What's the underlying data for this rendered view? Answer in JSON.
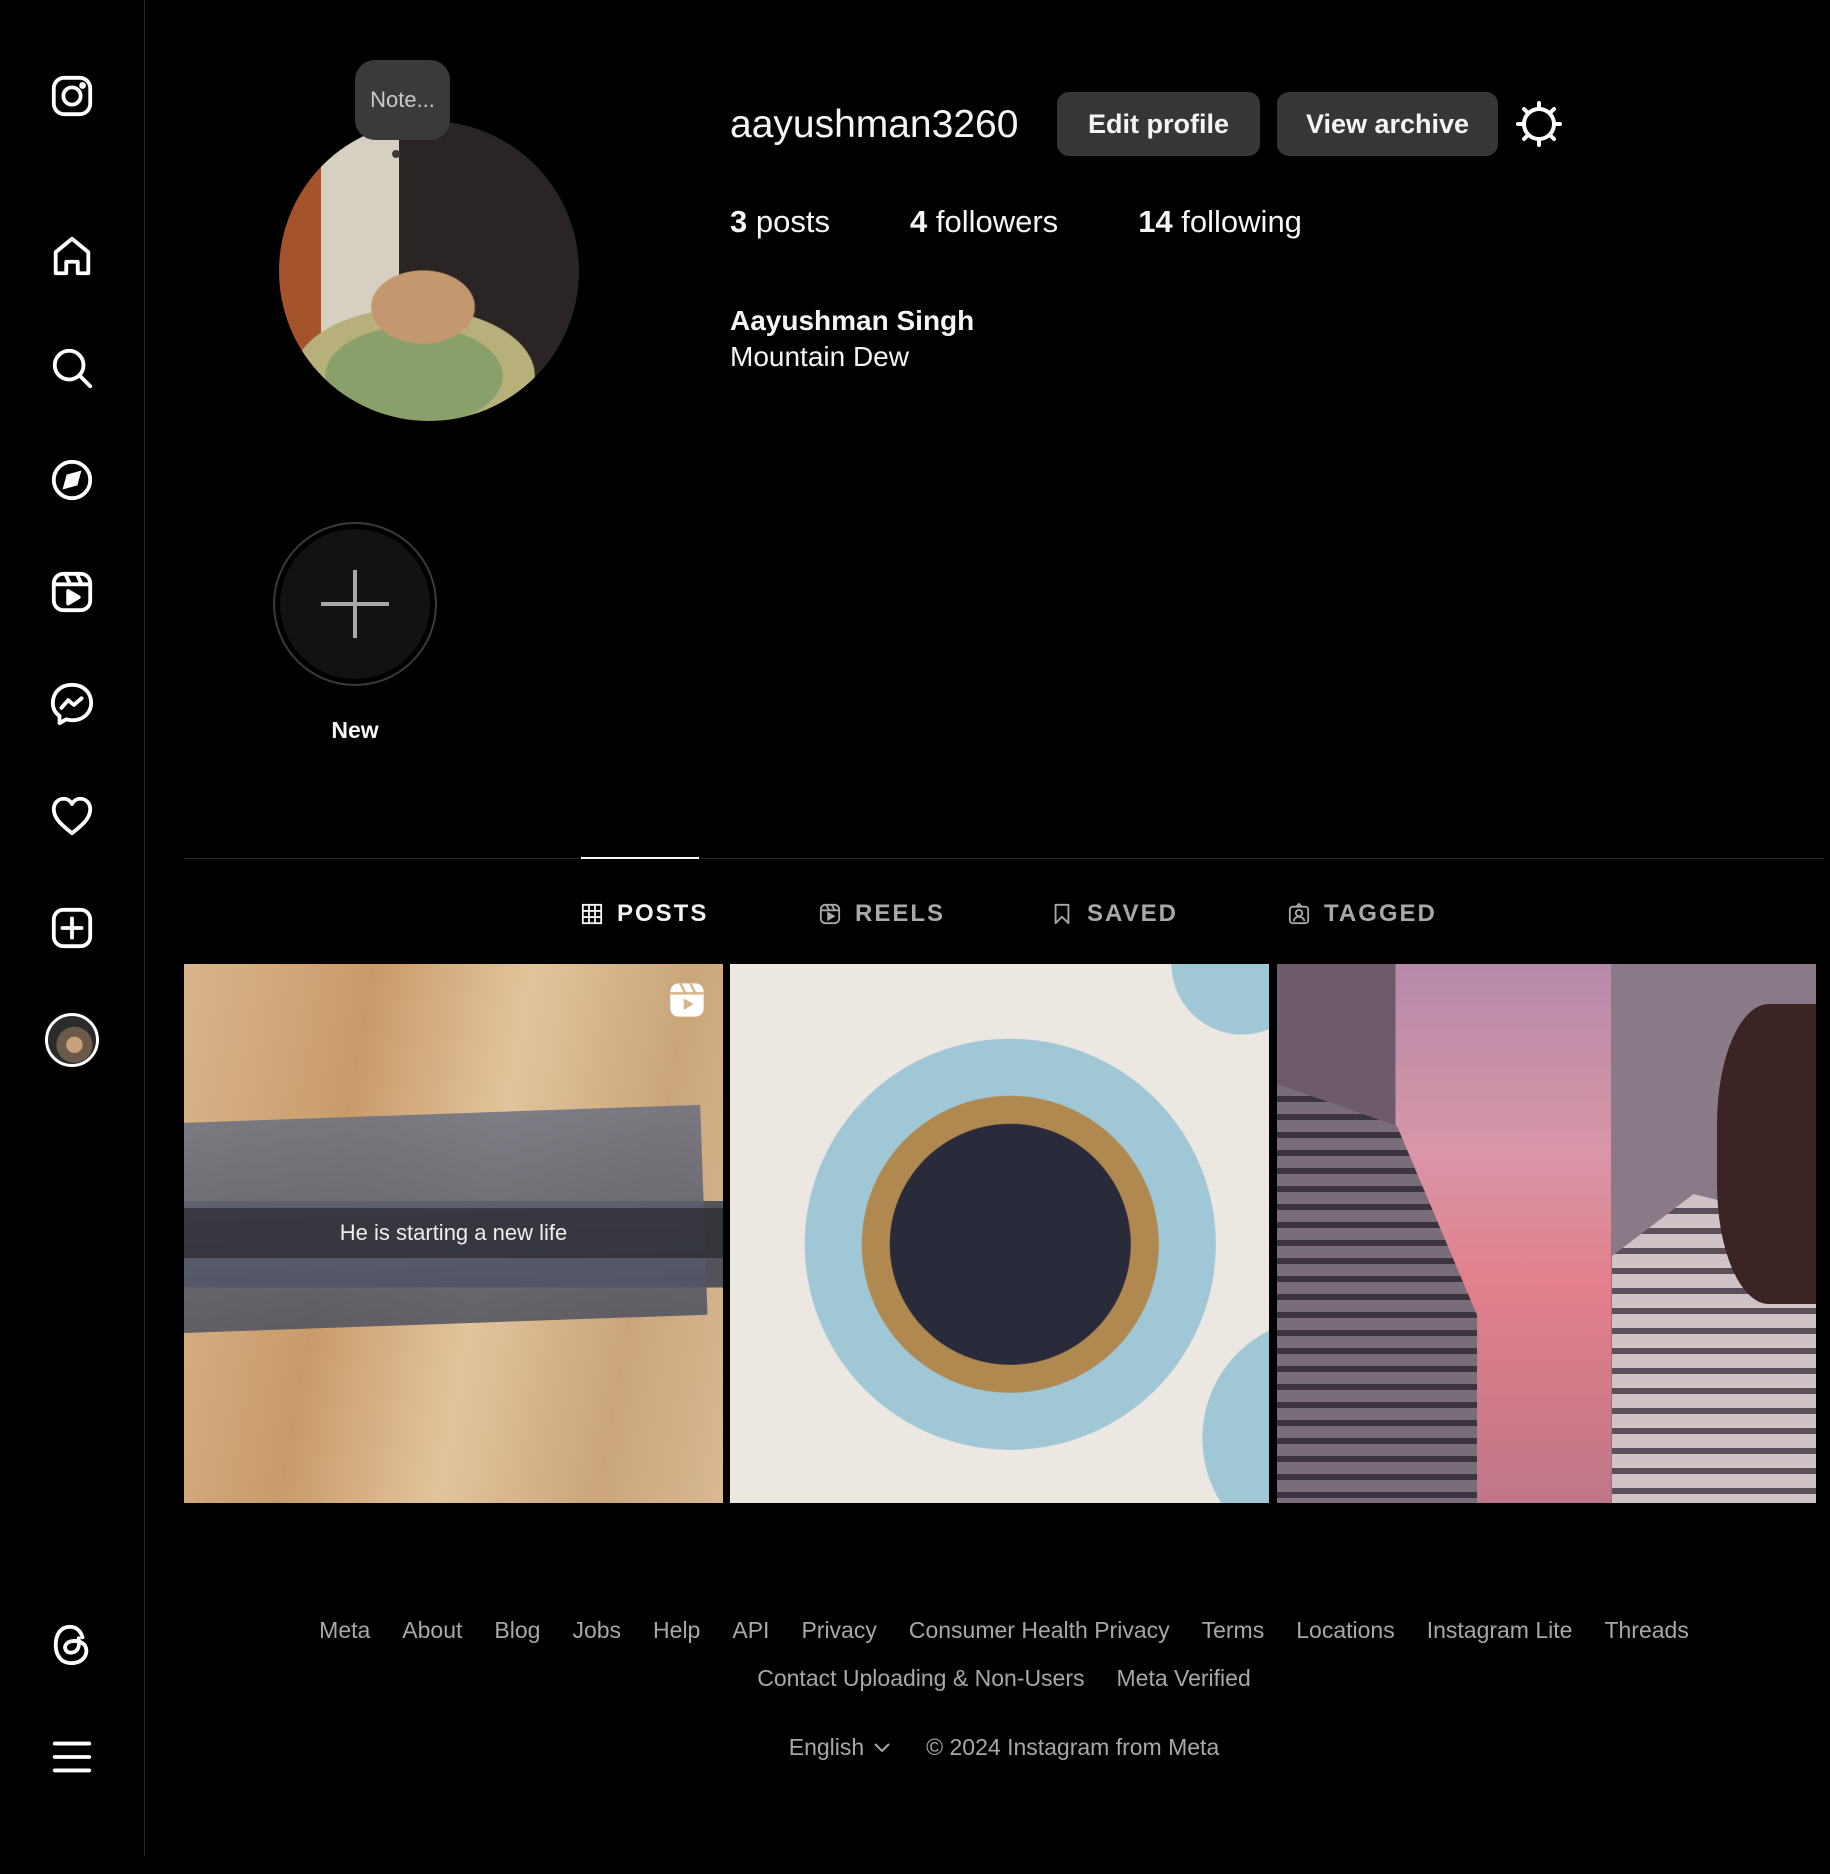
{
  "profile": {
    "note": "Note...",
    "username": "aayushman3260",
    "edit_profile": "Edit profile",
    "view_archive": "View archive",
    "posts_count": "3",
    "posts_label": "posts",
    "followers_count": "4",
    "followers_label": "followers",
    "following_count": "14",
    "following_label": "following",
    "full_name": "Aayushman Singh",
    "bio": "Mountain Dew"
  },
  "highlights": {
    "new_label": "New"
  },
  "tabs": [
    {
      "label": "POSTS",
      "icon": "grid-icon",
      "active": true
    },
    {
      "label": "REELS",
      "icon": "reels-icon",
      "active": false
    },
    {
      "label": "SAVED",
      "icon": "bookmark-icon",
      "active": false
    },
    {
      "label": "TAGGED",
      "icon": "tagged-icon",
      "active": false
    }
  ],
  "posts": [
    {
      "type": "reel",
      "caption": "He is starting a new life"
    },
    {
      "type": "photo",
      "caption": ""
    },
    {
      "type": "photo",
      "caption": ""
    }
  ],
  "sidebar": {
    "icons": [
      "instagram-logo-icon",
      "home-icon",
      "search-icon",
      "explore-icon",
      "reels-icon",
      "messenger-icon",
      "heart-icon",
      "create-icon",
      "profile-avatar",
      "threads-icon",
      "menu-icon"
    ]
  },
  "footer": {
    "links": [
      "Meta",
      "About",
      "Blog",
      "Jobs",
      "Help",
      "API",
      "Privacy",
      "Consumer Health Privacy",
      "Terms",
      "Locations",
      "Instagram Lite",
      "Threads",
      "Contact Uploading & Non-Users",
      "Meta Verified"
    ],
    "language": "English",
    "copyright": "© 2024 Instagram from Meta"
  },
  "colors": {
    "background": "#000000",
    "button": "#363636",
    "text": "#f5f5f5",
    "muted": "#a8a8a8"
  }
}
